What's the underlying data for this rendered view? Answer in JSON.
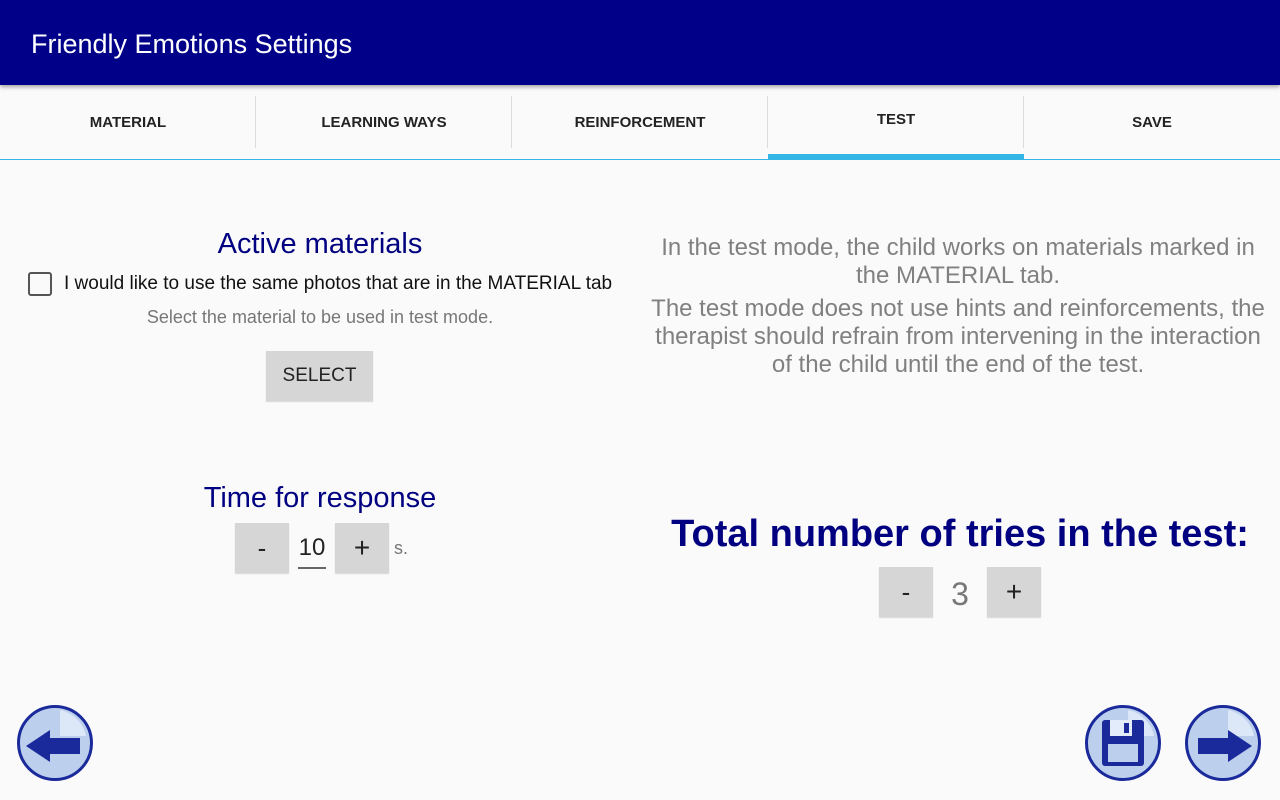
{
  "app": {
    "title": "Friendly Emotions Settings"
  },
  "tabs": [
    {
      "label": "MATERIAL"
    },
    {
      "label": "LEARNING WAYS"
    },
    {
      "label": "REINFORCEMENT"
    },
    {
      "label": "TEST"
    },
    {
      "label": "SAVE"
    }
  ],
  "active_materials": {
    "title": "Active materials",
    "checkbox_label": "I would like to use the same photos that are in the MATERIAL tab",
    "checked": false,
    "hint": "Select the material to be used in test mode.",
    "select_label": "SELECT"
  },
  "info": {
    "paragraph1": "In the test mode, the child works on materials marked in the MATERIAL tab.",
    "paragraph2": "The test mode does not use hints and reinforcements, the therapist should refrain from intervening in the interaction of the child until the end of the test."
  },
  "response_time": {
    "title": "Time for response",
    "minus": "-",
    "value": "10",
    "plus": "+",
    "unit": "s."
  },
  "tries": {
    "title": "Total number of tries in the test:",
    "minus": "-",
    "value": "3",
    "plus": "+"
  },
  "colors": {
    "app_bar": "#000088",
    "tab_indicator": "#33b5e5",
    "title_text": "#000080",
    "button_fill": "#bcd0ee"
  },
  "icons": {
    "back": "back-arrow-icon",
    "save": "floppy-disk-icon",
    "next": "forward-arrow-icon"
  }
}
